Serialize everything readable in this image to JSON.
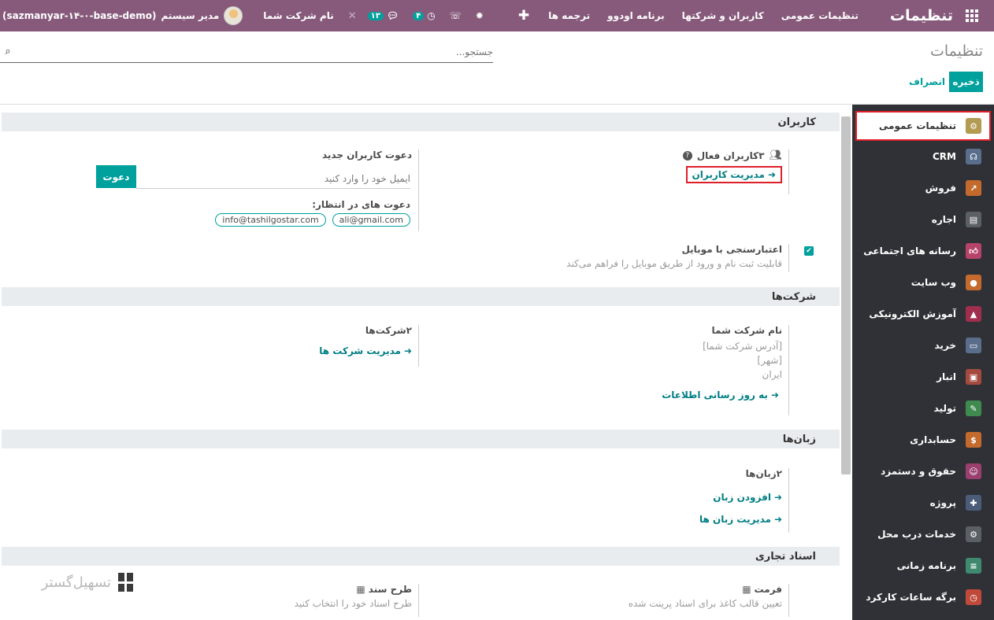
{
  "navbar": {
    "brand": "تنظیمات",
    "menu": [
      "تنظیمات عمومی",
      "کاربران و شرکتها",
      "برنامه اودوو",
      "ترجمه ها"
    ],
    "company": "نام شرکت شما",
    "user": "مدیر سیستم",
    "db": "(sazmanyar-۱۴-۰-base-demo)",
    "activity_count": "۴",
    "message_count": "۱۳"
  },
  "control": {
    "title": "تنظیمات",
    "search_placeholder": "جستجو...",
    "save": "ذخیره",
    "discard": "انصراف"
  },
  "sidebar": {
    "items": [
      {
        "label": "تنظیمات عمومی",
        "icon": "gear-icon",
        "color": "#b39b52"
      },
      {
        "label": "CRM",
        "icon": "handshake-icon",
        "color": "#5a6e8c"
      },
      {
        "label": "فروش",
        "icon": "chart-icon",
        "color": "#c46a2c"
      },
      {
        "label": "اجاره",
        "icon": "calendar-icon",
        "color": "#5b5f66"
      },
      {
        "label": "رسانه های اجتماعی",
        "icon": "thumbs-up-icon",
        "color": "#b8436a"
      },
      {
        "label": "وب سایت",
        "icon": "globe-icon",
        "color": "#c46a2c"
      },
      {
        "label": "آموزش الکترونیکی",
        "icon": "graduation-icon",
        "color": "#a02e4d"
      },
      {
        "label": "خرید",
        "icon": "credit-card-icon",
        "color": "#5a6e8c"
      },
      {
        "label": "انبار",
        "icon": "box-icon",
        "color": "#a44a3f"
      },
      {
        "label": "تولید",
        "icon": "wrench-icon",
        "color": "#3f8a4f"
      },
      {
        "label": "حسابداری",
        "icon": "invoice-icon",
        "color": "#c46a2c"
      },
      {
        "label": "حقوق و دستمزد",
        "icon": "payroll-icon",
        "color": "#9a3f6f"
      },
      {
        "label": "پروژه",
        "icon": "puzzle-icon",
        "color": "#4a5c7a"
      },
      {
        "label": "خدمات درب محل",
        "icon": "service-icon",
        "color": "#5b5f66"
      },
      {
        "label": "برنامه زمانی",
        "icon": "planning-icon",
        "color": "#3f8a6f"
      },
      {
        "label": "برگه ساعات کارکرد",
        "icon": "stopwatch-icon",
        "color": "#c04a3a"
      }
    ]
  },
  "users": {
    "title": "کاربران",
    "active_users": "۳کاربران فعال",
    "manage_users": "مدیریت کاربران",
    "invite_title": "دعوت کاربران جدید",
    "invite_placeholder": "ایمیل خود را وارد کنید",
    "invite_button": "دعوت",
    "pending_title": "دعوت های در انتظار:",
    "pending": [
      "ali@gmail.com",
      "info@tashilgostar.com"
    ],
    "mobile_title": "اعتبارسنجی با موبایل",
    "mobile_desc": "قابلیت ثبت نام و ورود از طریق موبایل را فراهم می‌کند"
  },
  "companies": {
    "title": "شرکت‌ها",
    "company_name": "نام شرکت شما",
    "address": "[آدرس شرکت شما]",
    "city": "[شهر]",
    "country": "ایران",
    "update_info": "به روز رسانی اطلاعات",
    "count": "۲شرکت‌ها",
    "manage": "مدیریت شرکت ها"
  },
  "languages": {
    "title": "زبان‌ها",
    "count": "۲زبان‌ها",
    "add": "افزودن زبان",
    "manage": "مدیریت زبان ها"
  },
  "documents": {
    "title": "اسناد تجاری",
    "format_title": "فرمت",
    "format_desc": "تعیین قالب کاغذ برای اسناد پرینت شده",
    "layout_title": "طرح سند",
    "layout_desc": "طرح اسناد خود را انتخاب کنید"
  },
  "watermark": "تسهیل‌گستر"
}
